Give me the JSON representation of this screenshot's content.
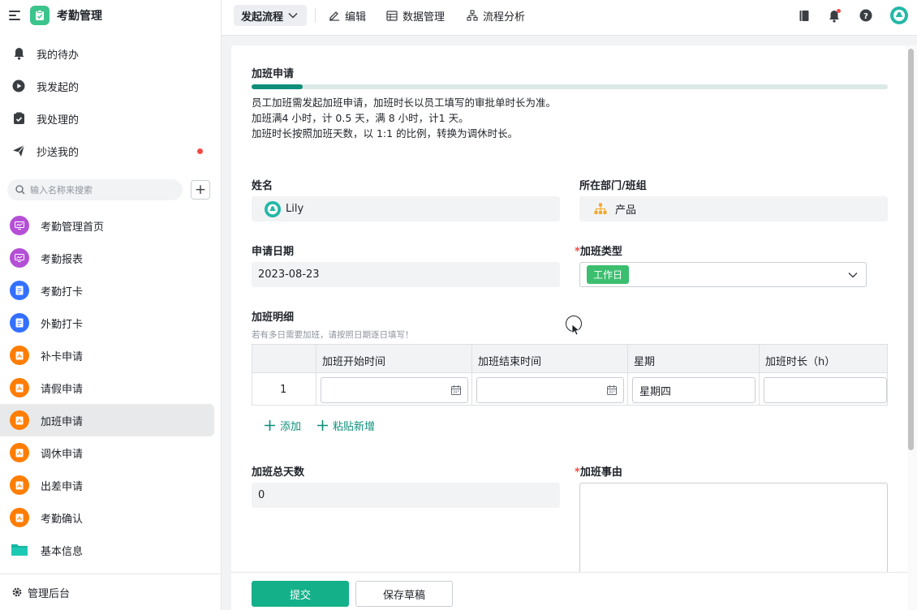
{
  "app": {
    "title": "考勤管理"
  },
  "sidebar": {
    "nav": [
      {
        "label": "我的待办",
        "icon": "bell-icon"
      },
      {
        "label": "我发起的",
        "icon": "play-circle-icon"
      },
      {
        "label": "我处理的",
        "icon": "check-box-icon"
      },
      {
        "label": "抄送我的",
        "icon": "send-icon"
      }
    ],
    "search_placeholder": "输入名称来搜索",
    "pages": [
      {
        "label": "考勤管理首页",
        "icon": "dashboard-icon",
        "color": "#b44fd6"
      },
      {
        "label": "考勤报表",
        "icon": "dashboard-icon",
        "color": "#b44fd6"
      },
      {
        "label": "考勤打卡",
        "icon": "form-icon",
        "color": "#3370ff"
      },
      {
        "label": "外勤打卡",
        "icon": "form-icon",
        "color": "#3370ff"
      },
      {
        "label": "补卡申请",
        "icon": "flow-icon",
        "color": "#ff7d00"
      },
      {
        "label": "请假申请",
        "icon": "flow-icon",
        "color": "#ff7d00"
      },
      {
        "label": "加班申请",
        "icon": "flow-icon",
        "color": "#ff7d00"
      },
      {
        "label": "调休申请",
        "icon": "flow-icon",
        "color": "#ff7d00"
      },
      {
        "label": "出差申请",
        "icon": "flow-icon",
        "color": "#ff7d00"
      },
      {
        "label": "考勤确认",
        "icon": "flow-icon",
        "color": "#ff7d00"
      },
      {
        "label": "基本信息",
        "icon": "folder-icon",
        "color": "#16b6a3"
      }
    ],
    "footer": "管理后台"
  },
  "topbar": {
    "launch": "发起流程",
    "edit": "编辑",
    "data_manage": "数据管理",
    "flow_analysis": "流程分析"
  },
  "form": {
    "title": "加班申请",
    "progress": 0.08,
    "desc": [
      "员工加班需发起加班申请，加班时长以员工填写的审批单时长为准。",
      "加班满4 小时，计 0.5 天，满 8 小时，计1 天。",
      "加班时长按照加班天数，以 1:1 的比例，转换为调休时长。"
    ],
    "name_label": "姓名",
    "name_value": "Lily",
    "dept_label": "所在部门/班组",
    "dept_value": "产品",
    "date_label": "申请日期",
    "date_value": "2023-08-23",
    "type_required": "*",
    "type_label": "加班类型",
    "type_value": "工作日",
    "detail_label": "加班明细",
    "detail_hint": "若有多日需要加班，请按照日期逐日填写！",
    "table": {
      "headers": [
        "加班开始时间",
        "加班结束时间",
        "星期",
        "加班时长（h）"
      ],
      "row_index": "1",
      "weekday": "星期四"
    },
    "add_label": "添加",
    "paste_label": "粘贴新增",
    "total_label": "加班总天数",
    "total_value": "0",
    "reason_required": "*",
    "reason_label": "加班事由",
    "submit": "提交",
    "draft": "保存草稿"
  },
  "colors": {
    "accent": "#14b08a",
    "tag": "#3bbf6f",
    "required": "#f54a45"
  }
}
